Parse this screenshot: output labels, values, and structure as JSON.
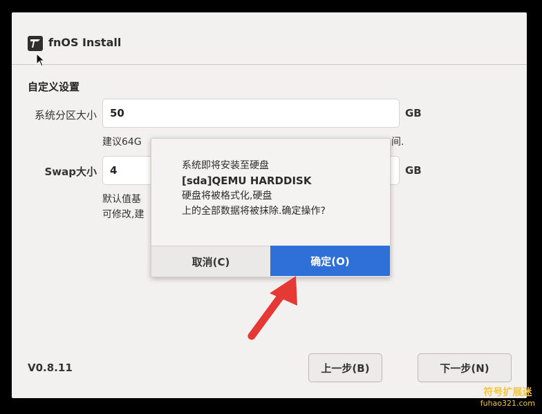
{
  "app": {
    "title": "fnOS Install",
    "icon": "fnos-logo-icon"
  },
  "section": {
    "title": "自定义设置"
  },
  "fields": {
    "system_partition": {
      "label": "系统分区大小",
      "value": "50",
      "unit": "GB",
      "hint": "建议64G"
    },
    "swap": {
      "label": "Swap大小",
      "value": "4",
      "unit": "GB",
      "hint_line1": "默认值基",
      "hint_line2": "可修改,建"
    }
  },
  "hint_trailing": "间.",
  "footer": {
    "version": "V0.8.11",
    "prev_label": "上一步(B)",
    "next_label": "下一步(N)"
  },
  "dialog": {
    "line1": "系统即将安装至硬盘",
    "line2": "[sda]QEMU HARDDISK",
    "line3": "硬盘将被格式化,硬盘",
    "line4": "上的全部数据将被抹除.确定操作?",
    "cancel_label": "取消(C)",
    "ok_label": "确定(O)"
  },
  "watermark": {
    "line1": "符号扩展迷",
    "line2": "fuhao321.com"
  },
  "colors": {
    "primary": "#2f6fd8",
    "annotation_arrow": "#e53935"
  }
}
